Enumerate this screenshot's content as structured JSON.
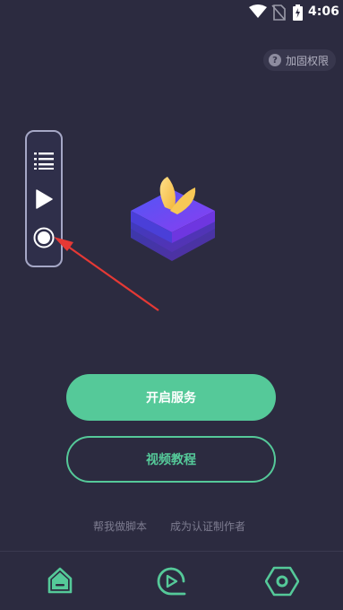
{
  "status_bar": {
    "time": "4:06",
    "icons": [
      "wifi-icon",
      "no-sim-icon",
      "battery-charging-icon"
    ]
  },
  "header": {
    "permission_label": "加固权限",
    "permission_icon": "help-circle-icon"
  },
  "floating_panel": {
    "icons": [
      "list-icon",
      "play-icon",
      "record-icon"
    ]
  },
  "main": {
    "start_service_label": "开启服务",
    "video_tutorial_label": "视频教程"
  },
  "links": {
    "help_write_script": "帮我做脚本",
    "become_certified_author": "成为认证制作者"
  },
  "bottom_nav": {
    "items": [
      {
        "icon": "home-icon",
        "active": true
      },
      {
        "icon": "video-play-icon",
        "active": false
      },
      {
        "icon": "settings-hexagon-icon",
        "active": false
      }
    ]
  },
  "colors": {
    "background": "#2c2b40",
    "accent": "#55c999",
    "arrow": "#e53935",
    "panel_border": "#a5a7c6"
  }
}
